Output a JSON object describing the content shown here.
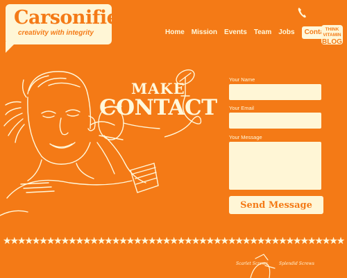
{
  "logo": {
    "name": "Carsonified",
    "tagline": "creativity with integrity"
  },
  "nav": {
    "items": [
      "Home",
      "Mission",
      "Events",
      "Team",
      "Jobs",
      "Contact"
    ],
    "active": "Contact"
  },
  "blog_badge": {
    "line1": "THINK",
    "line2": "VITAMIN",
    "line3": "BLOG"
  },
  "hero": {
    "line1": "MAKE",
    "line2": "CONTACT"
  },
  "form": {
    "name_label": "Your Name",
    "email_label": "Your Email",
    "message_label": "Your Message",
    "submit_label": "Send Message"
  },
  "footer": {
    "stars": "★★★★★★★★★★★★★★★★★★★★★★★★★★★★★★★★★★★★★★★★★★★★★★★★★★",
    "script_left": "Scarlet Screws",
    "script_right": "Splendid Screws"
  },
  "colors": {
    "background": "#f47a16",
    "cream": "#fff6d6"
  }
}
